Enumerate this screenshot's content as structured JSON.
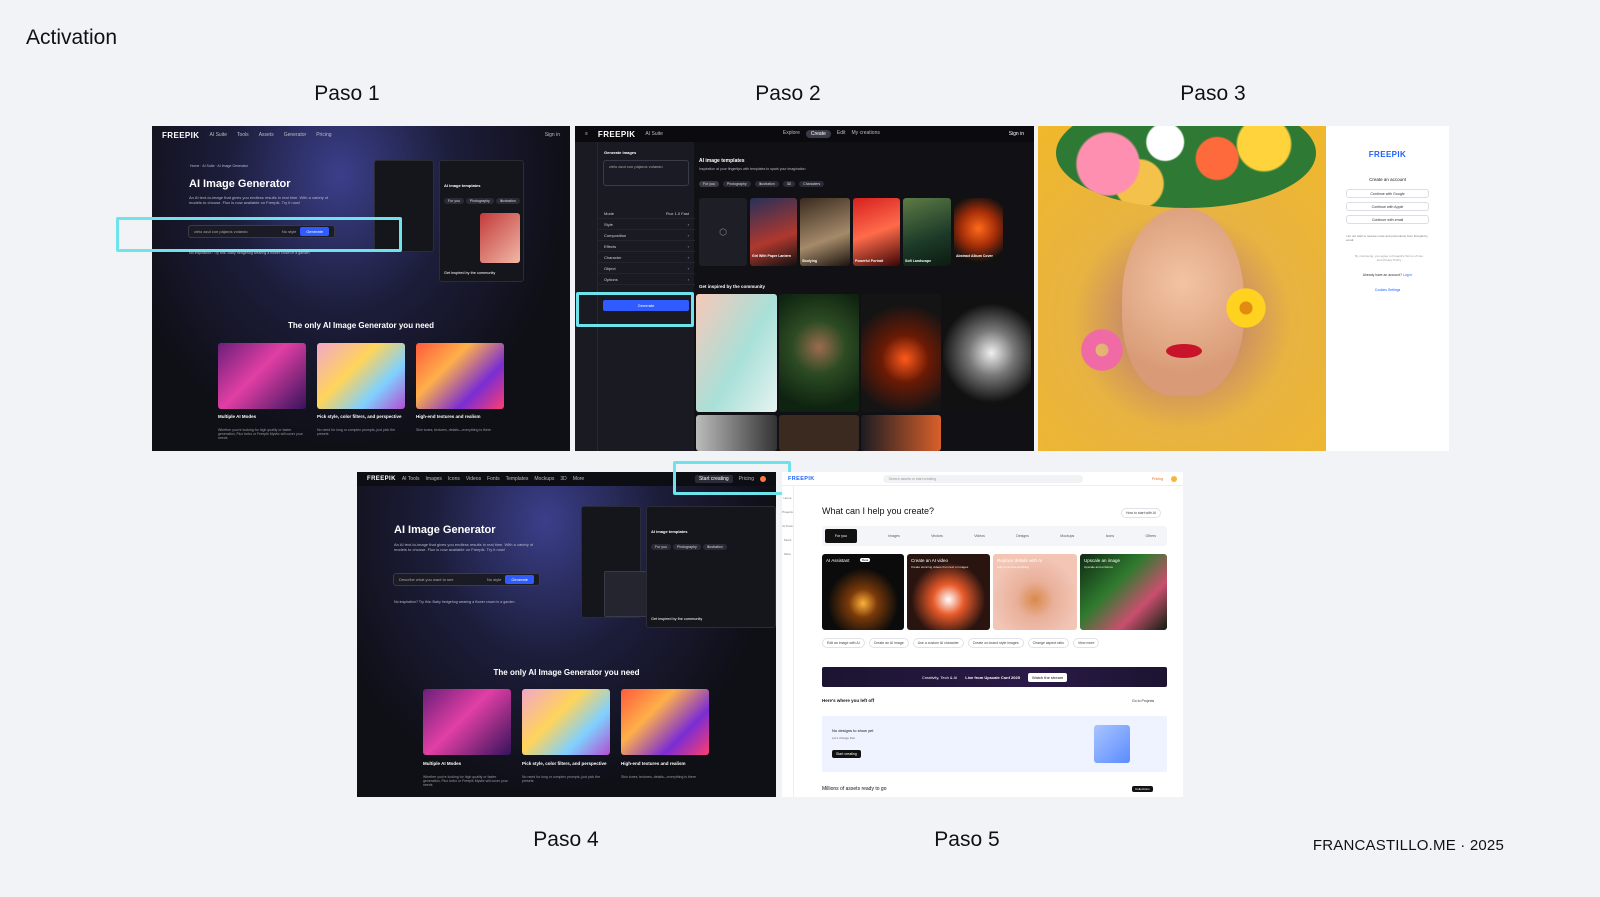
{
  "slide": {
    "title": "Activation",
    "footer": "FRANCASTILLO.ME · 2025"
  },
  "steps": [
    {
      "label": "Paso 1"
    },
    {
      "label": "Paso 2"
    },
    {
      "label": "Paso 3"
    },
    {
      "label": "Paso 4"
    },
    {
      "label": "Paso 5"
    }
  ],
  "paso1": {
    "logo": "FREEPIK",
    "nav": [
      "AI Suite",
      "Tools",
      "Assets",
      "Generator",
      "Pricing"
    ],
    "sign_in": "Sign in",
    "breadcrumb": "Home · AI Suite · AI Image Generator",
    "hero_title": "AI Image Generator",
    "hero_sub": "An AI text-to-image that gives you endless results in real time. With a variety of models to choose. Flux is now available on Freepik. Try it now!",
    "prompt_value": "cielo azul con pájaros volando",
    "style_select": "No style",
    "generate_label": "Generate",
    "inspiration": "No inspiration? Try this: Baby hedgehog wearing a flower crown in a garden",
    "panel_title": "AI image templates",
    "panel_tabs": [
      "For you",
      "Photography",
      "Illustration"
    ],
    "community": "Get inspired by the community",
    "section_title": "The only AI Image Generator you need",
    "features": [
      {
        "title": "Multiple AI Modes",
        "desc": "Whether you're looking for high quality or faster generation, Flux turbo or Freepik Mystic will cover your needs"
      },
      {
        "title": "Pick style, color filters, and perspective",
        "desc": "No need for long or complex prompts, just pick the presets"
      },
      {
        "title": "High-end textures and realism",
        "desc": "Skin tones, textures, details—everything is there"
      }
    ]
  },
  "paso2": {
    "logo": "FREEPIK",
    "suite": "AI Suite",
    "tabs": [
      "Explore",
      "Create",
      "Edit",
      "My creations"
    ],
    "active_tab": "Create",
    "sign_in": "Sign in",
    "side_title": "Generate images",
    "prompt": "cielo azul con pájaros volando",
    "menu": [
      "Mode",
      "Style",
      "Composition",
      "Effects",
      "Character",
      "Object",
      "Options"
    ],
    "mode_value": "Flux 1.0 Fast",
    "generate_label": "Generate",
    "templates_title": "AI image templates",
    "templates_sub": "Inspiration at your fingertips with templates to spark your imagination",
    "template_tabs": [
      "For you",
      "Photography",
      "Illustration",
      "3D",
      "Characters"
    ],
    "template_cards": [
      "Girl With Paper Lantern",
      "Studying",
      "Powerful Portrait",
      "Soft Landscape",
      "Abstract Album Cover"
    ],
    "community": "Get inspired by the community"
  },
  "paso3": {
    "logo": "FREEPIK",
    "heading": "Create an account",
    "buttons": [
      "Continue with Google",
      "Continue with Apple",
      "Continue with email"
    ],
    "checkbox": "I do not wish to receive news and promotions from Freepik by email.",
    "terms": "By continuing, you agree to Freepik's Terms of Use and Privacy Policy",
    "already": "Already have an account?",
    "login": "Log in",
    "cookies": "Cookies Settings"
  },
  "paso4": {
    "logo": "FREEPIK",
    "nav": [
      "AI Tools",
      "Images",
      "Icons",
      "Videos",
      "Fonts",
      "Templates",
      "Mockups",
      "3D",
      "More"
    ],
    "start_creating": "Start creating",
    "pricing": "Pricing",
    "hero_title": "AI Image Generator",
    "hero_sub": "An AI text-to-image that gives you endless results in real time. With a variety of models to choose. Flux is now available on Freepik. Try it now!",
    "prompt_placeholder": "Describe what you want to see",
    "style_select": "No style",
    "generate_label": "Generate",
    "inspiration": "No inspiration? Try this: Baby hedgehog wearing a flower crown in a garden",
    "panel_title": "AI image templates",
    "panel_tabs": [
      "For you",
      "Photography",
      "Illustration"
    ],
    "community": "Get inspired by the community",
    "section_title": "The only AI Image Generator you need",
    "features": [
      {
        "title": "Multiple AI Modes",
        "desc": "Whether you're looking for high quality or faster generation, Flux turbo or Freepik Mystic will cover your needs"
      },
      {
        "title": "Pick style, color filters, and perspective",
        "desc": "No need for long or complex prompts, just pick the presets"
      },
      {
        "title": "High-end textures and realism",
        "desc": "Skin tones, textures, details—everything is there"
      }
    ]
  },
  "paso5": {
    "logo": "FREEPIK",
    "search_placeholder": "Search assets or start creating",
    "pricing": "Pricing",
    "sidebar": [
      "Home",
      "Projects",
      "AI Tools",
      "Stock",
      "More"
    ],
    "heading": "What can I help you create?",
    "how_to": "How to start with AI",
    "tools": [
      "For you",
      "Images",
      "Vectors",
      "Videos",
      "Designs",
      "Mockups",
      "Icons",
      "Others"
    ],
    "cards": [
      "AI Assistant",
      "Create an AI video",
      "Replace details with AI",
      "Upscale an image"
    ],
    "card_subs": [
      "",
      "Create stunning videos from text or images",
      "Add or remove anything",
      "Upscale and enhance"
    ],
    "badge": "Beta",
    "actions": [
      "Edit an image with AI",
      "Create an AI image",
      "Use a custom AI character",
      "Create on-brand style images",
      "Change aspect ratio",
      "View more"
    ],
    "banner_left": "Creativity, Tech & AI",
    "banner_mid": "Live from Upscale Conf 2025",
    "banner_btn": "Watch the stream",
    "left_off": "Here's where you left off",
    "projects_link": "Go to Projects",
    "empty_title": "No designs to show yet",
    "empty_sub": "Let's change that",
    "start_btn": "Start creating",
    "millions": "Millions of assets ready to go",
    "collections": "Collections"
  },
  "colors": {
    "highlight": "#6fe3ec",
    "background": "#f1f3f7",
    "freepik_blue": "#1f62ff"
  }
}
